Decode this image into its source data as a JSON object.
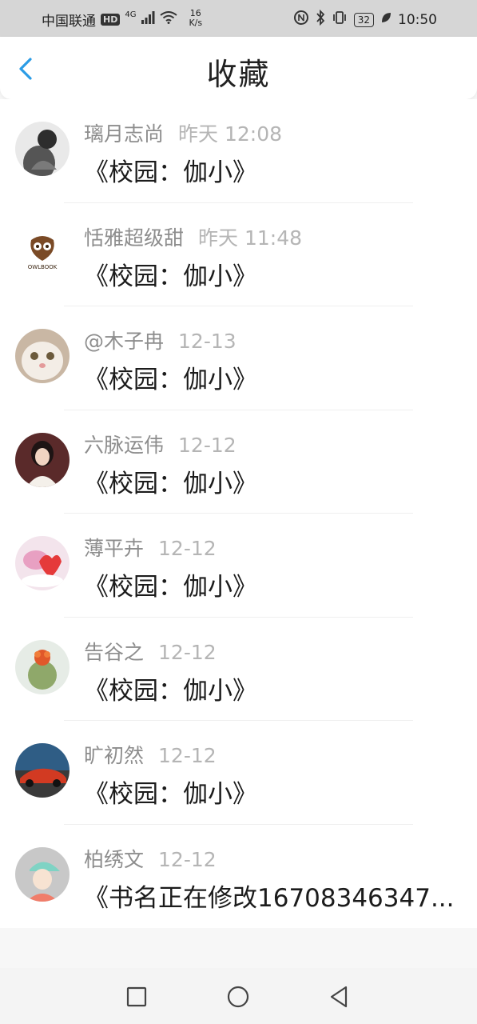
{
  "status_bar": {
    "carrier": "中国联通",
    "hd": "HD",
    "network": "4G",
    "speed_value": "16",
    "speed_unit": "K/s",
    "battery": "32",
    "time": "10:50"
  },
  "header": {
    "title": "收藏",
    "back_icon": "chevron-left-icon",
    "accent_color": "#2a9ce6"
  },
  "favorites": [
    {
      "user": "璃月志尚",
      "time": "昨天 12:08",
      "book": "《校园：伽小》"
    },
    {
      "user": "恬雅超级甜",
      "time": "昨天 11:48",
      "book": "《校园：伽小》"
    },
    {
      "user": "@木子冉",
      "time": "12-13",
      "book": "《校园：伽小》"
    },
    {
      "user": "六脉运伟",
      "time": "12-12",
      "book": "《校园：伽小》"
    },
    {
      "user": "薄平卉",
      "time": "12-12",
      "book": "《校园：伽小》"
    },
    {
      "user": "告谷之",
      "time": "12-12",
      "book": "《校园：伽小》"
    },
    {
      "user": "旷初然",
      "time": "12-12",
      "book": "《校园：伽小》"
    },
    {
      "user": "柏绣文",
      "time": "12-12",
      "book": "《书名正在修改16708346347..."
    }
  ],
  "nav": {
    "recent_icon": "square-icon",
    "home_icon": "circle-icon",
    "back_icon": "triangle-back-icon"
  }
}
